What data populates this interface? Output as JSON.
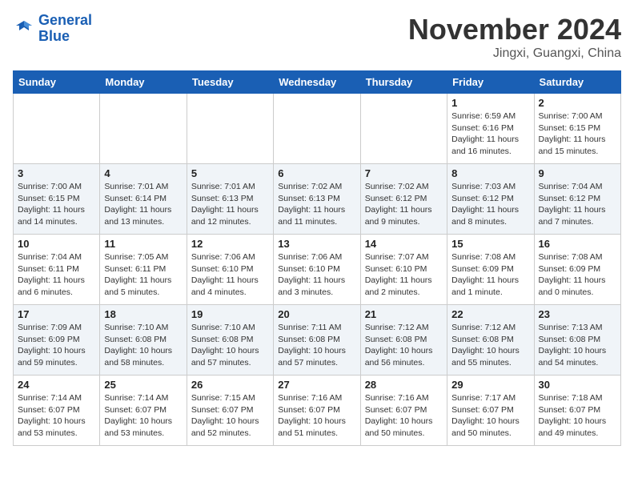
{
  "header": {
    "logo_line1": "General",
    "logo_line2": "Blue",
    "month_title": "November 2024",
    "location": "Jingxi, Guangxi, China"
  },
  "days_of_week": [
    "Sunday",
    "Monday",
    "Tuesday",
    "Wednesday",
    "Thursday",
    "Friday",
    "Saturday"
  ],
  "weeks": [
    [
      {
        "day": "",
        "info": ""
      },
      {
        "day": "",
        "info": ""
      },
      {
        "day": "",
        "info": ""
      },
      {
        "day": "",
        "info": ""
      },
      {
        "day": "",
        "info": ""
      },
      {
        "day": "1",
        "info": "Sunrise: 6:59 AM\nSunset: 6:16 PM\nDaylight: 11 hours\nand 16 minutes."
      },
      {
        "day": "2",
        "info": "Sunrise: 7:00 AM\nSunset: 6:15 PM\nDaylight: 11 hours\nand 15 minutes."
      }
    ],
    [
      {
        "day": "3",
        "info": "Sunrise: 7:00 AM\nSunset: 6:15 PM\nDaylight: 11 hours\nand 14 minutes."
      },
      {
        "day": "4",
        "info": "Sunrise: 7:01 AM\nSunset: 6:14 PM\nDaylight: 11 hours\nand 13 minutes."
      },
      {
        "day": "5",
        "info": "Sunrise: 7:01 AM\nSunset: 6:13 PM\nDaylight: 11 hours\nand 12 minutes."
      },
      {
        "day": "6",
        "info": "Sunrise: 7:02 AM\nSunset: 6:13 PM\nDaylight: 11 hours\nand 11 minutes."
      },
      {
        "day": "7",
        "info": "Sunrise: 7:02 AM\nSunset: 6:12 PM\nDaylight: 11 hours\nand 9 minutes."
      },
      {
        "day": "8",
        "info": "Sunrise: 7:03 AM\nSunset: 6:12 PM\nDaylight: 11 hours\nand 8 minutes."
      },
      {
        "day": "9",
        "info": "Sunrise: 7:04 AM\nSunset: 6:12 PM\nDaylight: 11 hours\nand 7 minutes."
      }
    ],
    [
      {
        "day": "10",
        "info": "Sunrise: 7:04 AM\nSunset: 6:11 PM\nDaylight: 11 hours\nand 6 minutes."
      },
      {
        "day": "11",
        "info": "Sunrise: 7:05 AM\nSunset: 6:11 PM\nDaylight: 11 hours\nand 5 minutes."
      },
      {
        "day": "12",
        "info": "Sunrise: 7:06 AM\nSunset: 6:10 PM\nDaylight: 11 hours\nand 4 minutes."
      },
      {
        "day": "13",
        "info": "Sunrise: 7:06 AM\nSunset: 6:10 PM\nDaylight: 11 hours\nand 3 minutes."
      },
      {
        "day": "14",
        "info": "Sunrise: 7:07 AM\nSunset: 6:10 PM\nDaylight: 11 hours\nand 2 minutes."
      },
      {
        "day": "15",
        "info": "Sunrise: 7:08 AM\nSunset: 6:09 PM\nDaylight: 11 hours\nand 1 minute."
      },
      {
        "day": "16",
        "info": "Sunrise: 7:08 AM\nSunset: 6:09 PM\nDaylight: 11 hours\nand 0 minutes."
      }
    ],
    [
      {
        "day": "17",
        "info": "Sunrise: 7:09 AM\nSunset: 6:09 PM\nDaylight: 10 hours\nand 59 minutes."
      },
      {
        "day": "18",
        "info": "Sunrise: 7:10 AM\nSunset: 6:08 PM\nDaylight: 10 hours\nand 58 minutes."
      },
      {
        "day": "19",
        "info": "Sunrise: 7:10 AM\nSunset: 6:08 PM\nDaylight: 10 hours\nand 57 minutes."
      },
      {
        "day": "20",
        "info": "Sunrise: 7:11 AM\nSunset: 6:08 PM\nDaylight: 10 hours\nand 57 minutes."
      },
      {
        "day": "21",
        "info": "Sunrise: 7:12 AM\nSunset: 6:08 PM\nDaylight: 10 hours\nand 56 minutes."
      },
      {
        "day": "22",
        "info": "Sunrise: 7:12 AM\nSunset: 6:08 PM\nDaylight: 10 hours\nand 55 minutes."
      },
      {
        "day": "23",
        "info": "Sunrise: 7:13 AM\nSunset: 6:08 PM\nDaylight: 10 hours\nand 54 minutes."
      }
    ],
    [
      {
        "day": "24",
        "info": "Sunrise: 7:14 AM\nSunset: 6:07 PM\nDaylight: 10 hours\nand 53 minutes."
      },
      {
        "day": "25",
        "info": "Sunrise: 7:14 AM\nSunset: 6:07 PM\nDaylight: 10 hours\nand 53 minutes."
      },
      {
        "day": "26",
        "info": "Sunrise: 7:15 AM\nSunset: 6:07 PM\nDaylight: 10 hours\nand 52 minutes."
      },
      {
        "day": "27",
        "info": "Sunrise: 7:16 AM\nSunset: 6:07 PM\nDaylight: 10 hours\nand 51 minutes."
      },
      {
        "day": "28",
        "info": "Sunrise: 7:16 AM\nSunset: 6:07 PM\nDaylight: 10 hours\nand 50 minutes."
      },
      {
        "day": "29",
        "info": "Sunrise: 7:17 AM\nSunset: 6:07 PM\nDaylight: 10 hours\nand 50 minutes."
      },
      {
        "day": "30",
        "info": "Sunrise: 7:18 AM\nSunset: 6:07 PM\nDaylight: 10 hours\nand 49 minutes."
      }
    ]
  ]
}
